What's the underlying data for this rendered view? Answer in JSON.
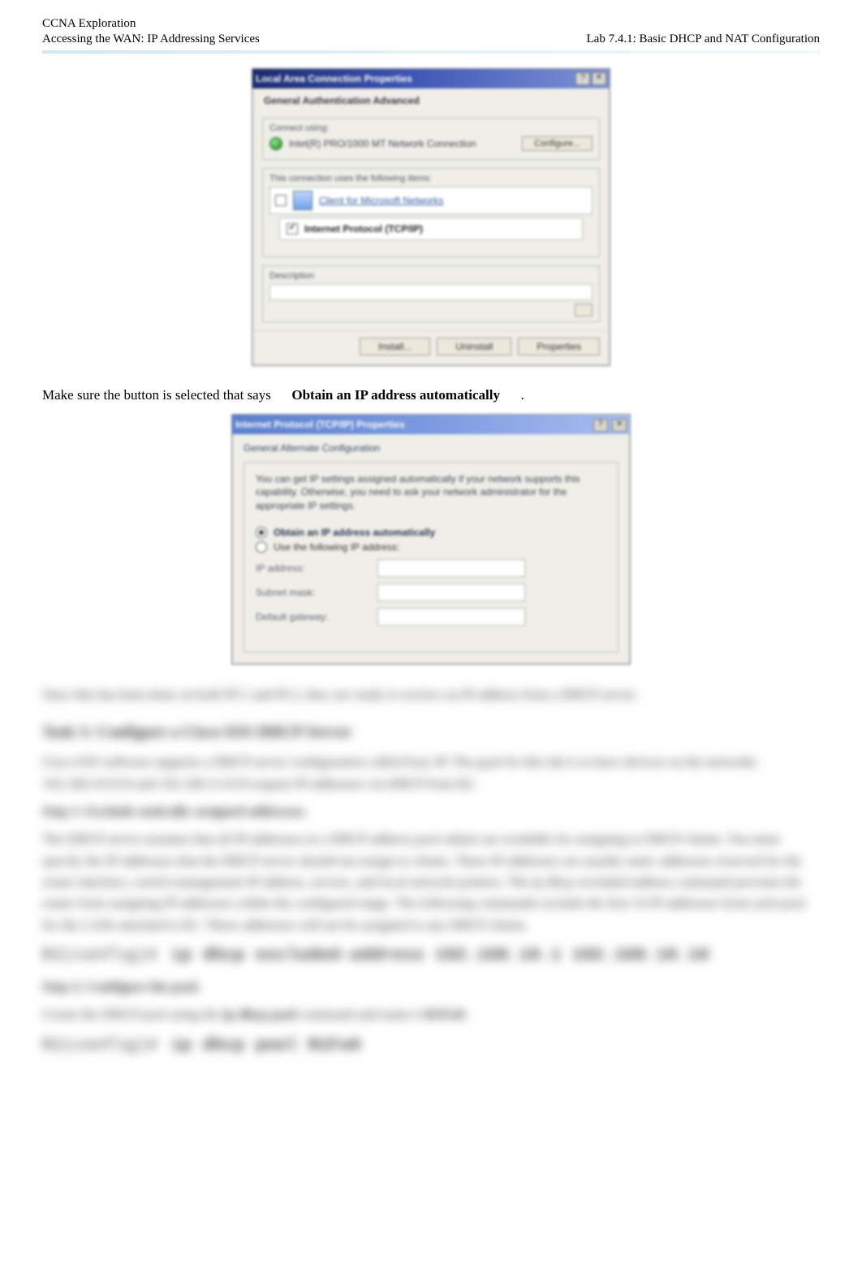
{
  "header": {
    "line1_left": "CCNA Exploration",
    "line2_left": "Accessing the WAN: IP Addressing Services",
    "line_right": "Lab 7.4.1: Basic DHCP and NAT Configuration"
  },
  "wizard1": {
    "title": "Local Area Connection Properties",
    "icons": {
      "help": "?",
      "close": "✕"
    },
    "heading": "General   Authentication   Advanced",
    "connect_using_label": "Connect using:",
    "status_text": "Intel(R) PRO/1000 MT Network Connection",
    "configure_btn": "Configure...",
    "items_label": "This connection uses the following items:",
    "nic_name": "Client for Microsoft Networks",
    "checked_item": "Internet Protocol (TCP/IP)",
    "desc_label": "Description",
    "desc_field": "",
    "install_btn": "Install...",
    "uninstall_btn": "Uninstall",
    "properties_btn": "Properties"
  },
  "body_line1": {
    "pre": "Make sure the button is selected that says",
    "bold": "Obtain an IP address automatically",
    "post": "."
  },
  "wizard2": {
    "title": "Internet Protocol (TCP/IP) Properties",
    "icons": {
      "help": "?",
      "close": "✕"
    },
    "tab_label": "General   Alternate Configuration",
    "paragraph": "You can get IP settings assigned automatically if your network supports this capability. Otherwise, you need to ask your network administrator for the appropriate IP settings.",
    "radio_auto": "Obtain an IP address automatically",
    "radio_manual": "Use the following IP address:",
    "ip_label": "IP address:",
    "mask_label": "Subnet mask:",
    "gateway_label": "Default gateway:"
  },
  "blurred": {
    "line1": "Once this has been done on both PC1 and PC2, they are ready to receive an IP address from a DHCP server.",
    "heading1": "Task 3: Configure a Cisco IOS DHCP Server",
    "para1": "Cisco IOS software supports a DHCP server configuration called Easy IP. The goal for this lab is to have devices on the networks 192.168.10.0/24 and 192.168.11.0/24 request IP addresses via DHCP from R2.",
    "step1": "Step 1: Exclude statically assigned addresses.",
    "para2": "The DHCP server assumes that all IP addresses in a DHCP address pool subnet are available for assigning to DHCP clients. You must specify the IP addresses that the DHCP server should not assign to clients. These IP addresses are usually static addresses reserved for the router interface, switch management IP address, servers, and local network printers. The ip dhcp excluded-address command prevents the router from assigning IP addresses within the configured range. The following commands exclude the first 10 IP addresses from each pool for the LANs attached to R1. These addresses will not be assigned to any DHCP clients.",
    "mono1_a": "R2(config)#",
    "mono1_b": "ip dhcp excluded-address 192.168.10.1 192.168.10.10",
    "step2": "Step 2: Configure the pool.",
    "para3_a": "Create the DHCP pool using the",
    "para3_b": "ip dhcp pool",
    "para3_c": "command and name it",
    "para3_d": "R1Fa0",
    "para3_e": ".",
    "mono2_a": "R2(config)#",
    "mono2_b": "ip dhcp pool R1Fa0"
  }
}
